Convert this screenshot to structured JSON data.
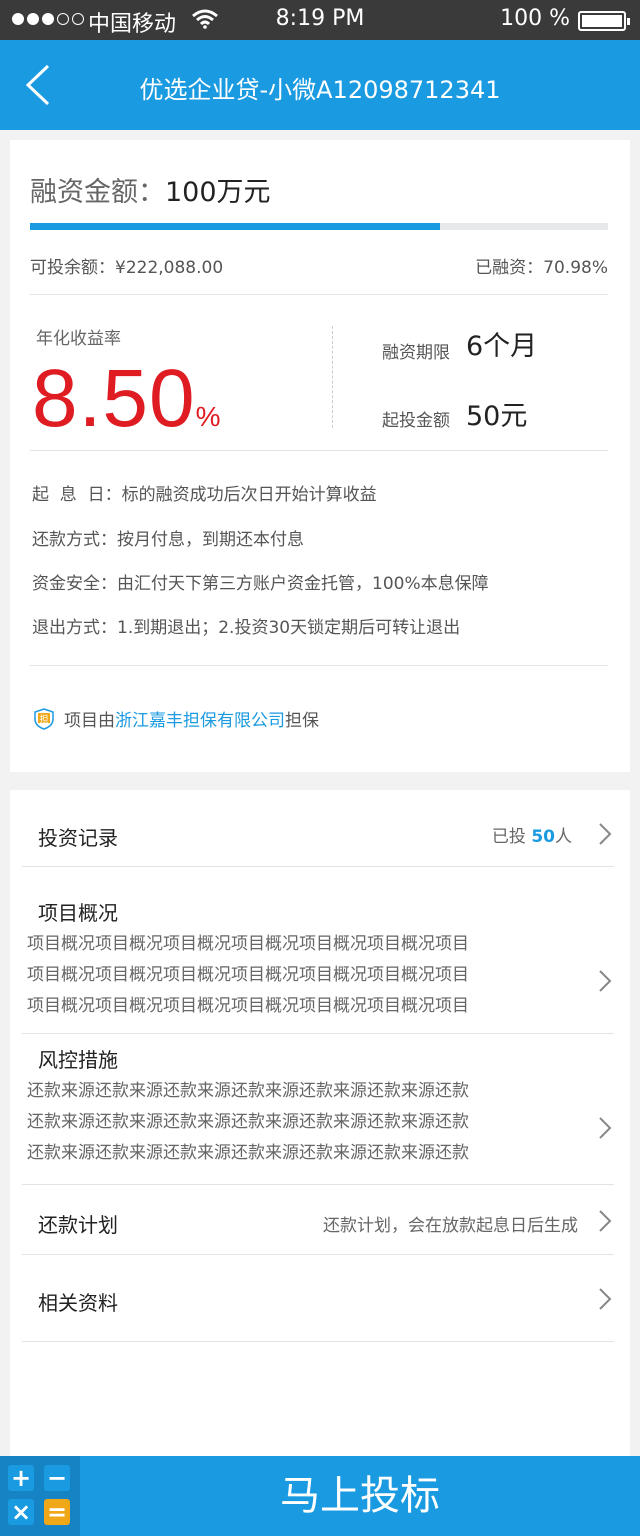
{
  "status_bar": {
    "carrier": "中国移动",
    "time": "8:19 PM",
    "battery": "100 %"
  },
  "nav": {
    "title": "优选企业贷-小微A12098712341"
  },
  "loan": {
    "amount_label": "融资金额：",
    "amount_value": "100万元",
    "progress_fraction": 0.7098,
    "remaining_label": "可投余额：",
    "remaining_value": "¥222,088.00",
    "raised_label": "已融资：",
    "raised_value": "70.98%",
    "rate_label": "年化收益率",
    "rate_value": "8.50",
    "rate_unit": "%",
    "term_label": "融资期限",
    "term_value": "6个月",
    "min_label": "起投金额",
    "min_value": "50元"
  },
  "details": [
    {
      "text": "起  息  日：标的融资成功后次日开始计算收益"
    },
    {
      "text": "还款方式：按月付息，到期还本付息"
    },
    {
      "text": "资金安全：由汇付天下第三方账户资金托管，100%本息保障"
    },
    {
      "text": "退出方式：1.到期退出；2.投资30天锁定期后可转让退出"
    }
  ],
  "guarantee": {
    "icon_char": "担",
    "prefix": "项目由",
    "company": "浙江嘉丰担保有限公司",
    "suffix": "担保"
  },
  "sections": {
    "records": {
      "title": "投资记录",
      "prefix": "已投 ",
      "count": "50",
      "suffix": "人"
    },
    "overview": {
      "title": "项目概况",
      "text": "项目概况项目概况项目概况项目概况项目概况项目概况项目\n项目概况项目概况项目概况项目概况项目概况项目概况项目\n项目概况项目概况项目概况项目概况项目概况项目概况项目"
    },
    "risk": {
      "title": "风控措施",
      "text": "还款来源还款来源还款来源还款来源还款来源还款来源还款\n还款来源还款来源还款来源还款来源还款来源还款来源还款\n还款来源还款来源还款来源还款来源还款来源还款来源还款"
    },
    "plan": {
      "title": "还款计划",
      "note": "还款计划，会在放款起息日后生成"
    },
    "docs": {
      "title": "相关资料"
    }
  },
  "bottom": {
    "invest_label": "马上投标",
    "calc_keys": [
      "+",
      "−",
      "×",
      "="
    ]
  },
  "colors": {
    "brand_blue": "#1a9ae0",
    "rate_red": "#e01c23",
    "calc_orange": "#f0a818"
  }
}
